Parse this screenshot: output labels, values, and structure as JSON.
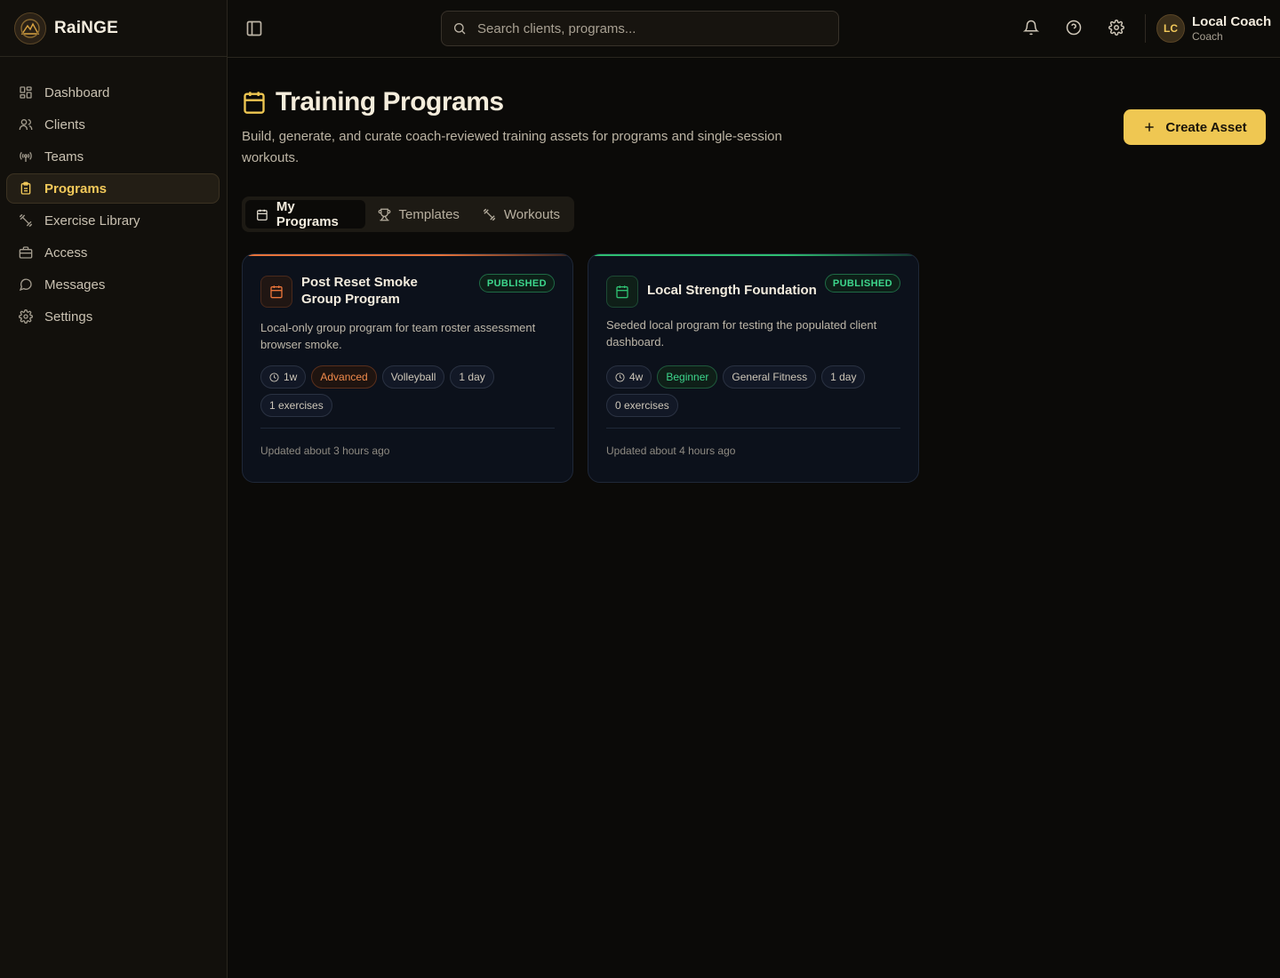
{
  "brand": {
    "name": "RaiNGE"
  },
  "sidebar": {
    "items": [
      {
        "label": "Dashboard",
        "icon": "dashboard-grid-icon",
        "active": false
      },
      {
        "label": "Clients",
        "icon": "users-icon",
        "active": false
      },
      {
        "label": "Teams",
        "icon": "broadcast-icon",
        "active": false
      },
      {
        "label": "Programs",
        "icon": "clipboard-icon",
        "active": true
      },
      {
        "label": "Exercise Library",
        "icon": "dumbbell-icon",
        "active": false
      },
      {
        "label": "Access",
        "icon": "briefcase-icon",
        "active": false
      },
      {
        "label": "Messages",
        "icon": "message-circle-icon",
        "active": false
      },
      {
        "label": "Settings",
        "icon": "gear-icon",
        "active": false
      }
    ]
  },
  "topbar": {
    "search_placeholder": "Search clients, programs...",
    "user": {
      "initials": "LC",
      "name": "Local Coach",
      "role": "Coach"
    }
  },
  "page": {
    "title": "Training Programs",
    "subtitle": "Build, generate, and curate coach-reviewed training assets for programs and single-session workouts.",
    "create_label": "Create Asset",
    "tabs": [
      {
        "label": "My Programs",
        "active": true
      },
      {
        "label": "Templates",
        "active": false
      },
      {
        "label": "Workouts",
        "active": false
      }
    ]
  },
  "programs": [
    {
      "title": "Post Reset Smoke Group Program",
      "status": "PUBLISHED",
      "description": "Local-only group program for team roster assessment browser smoke.",
      "duration": "1w",
      "level": "Advanced",
      "sport": "Volleyball",
      "days": "1 day",
      "exercises": "1 exercises",
      "updated": "Updated about 3 hours ago",
      "accent_color": "#e8743a",
      "level_color": "#f08a4b"
    },
    {
      "title": "Local Strength Foundation",
      "status": "PUBLISHED",
      "description": "Seeded local program for testing the populated client dashboard.",
      "duration": "4w",
      "level": "Beginner",
      "sport": "General Fitness",
      "days": "1 day",
      "exercises": "0 exercises",
      "updated": "Updated about 4 hours ago",
      "accent_color": "#2fbf71",
      "level_color": "#3dd68c"
    }
  ],
  "colors": {
    "accent": "#efc752",
    "published_text": "#3dd68c",
    "published_border": "#1f6b45"
  }
}
